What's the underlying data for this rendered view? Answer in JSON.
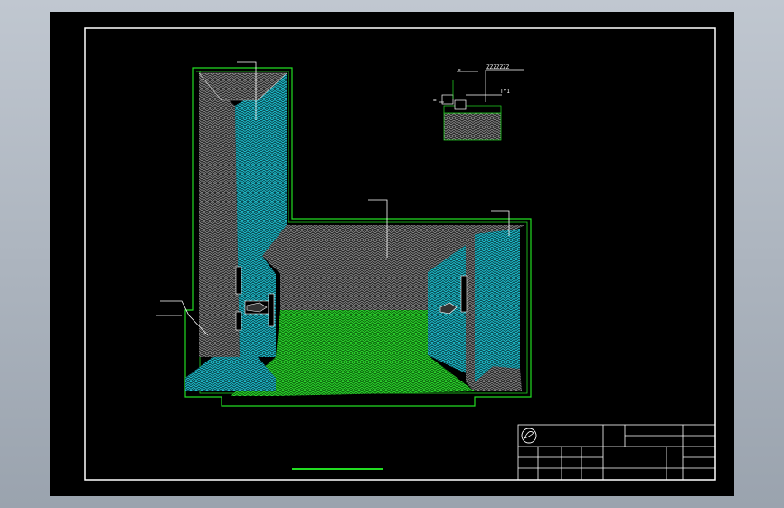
{
  "drawing": {
    "background": "#000000",
    "frame_color": "#ffffff",
    "outline_color": "#22dd22",
    "roof_fill_light": "#20c8d8",
    "roof_fill_dark": "#5a5a5a",
    "ground_fill": "#22e022",
    "annotation_color": "#ffffff"
  },
  "detail": {
    "label_top": "ZZZZZZZ",
    "label_right": "TY1",
    "label_small": "=",
    "label_left": "="
  },
  "title_block": {
    "logo": "logo-icon"
  }
}
